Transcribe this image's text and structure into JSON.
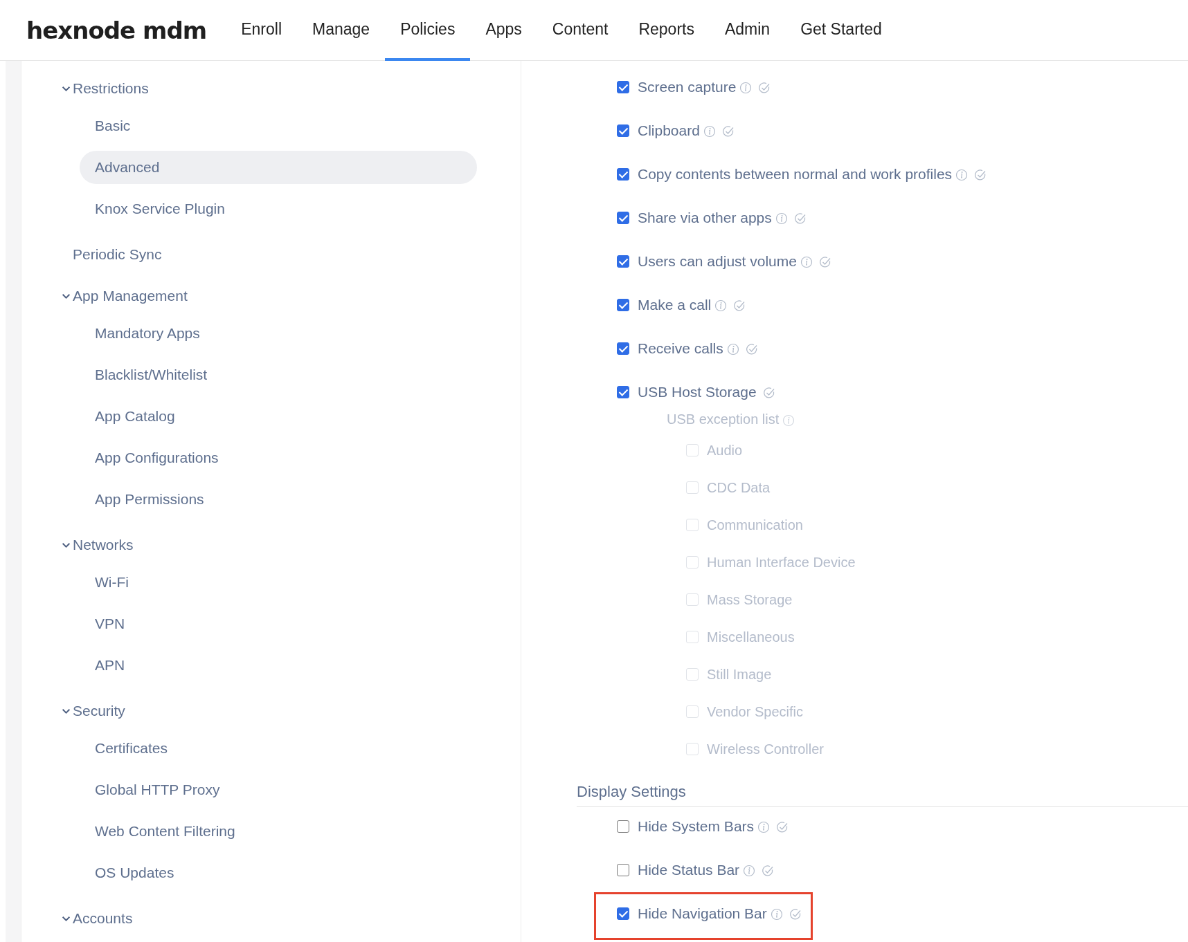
{
  "header": {
    "logo": "hexnode mdm",
    "nav": [
      {
        "label": "Enroll",
        "selected": false
      },
      {
        "label": "Manage",
        "selected": false
      },
      {
        "label": "Policies",
        "selected": true
      },
      {
        "label": "Apps",
        "selected": false
      },
      {
        "label": "Content",
        "selected": false
      },
      {
        "label": "Reports",
        "selected": false
      },
      {
        "label": "Admin",
        "selected": false
      },
      {
        "label": "Get Started",
        "selected": false
      }
    ]
  },
  "sidebar": {
    "items": [
      {
        "label": "Restrictions",
        "expanded": true,
        "children": [
          {
            "label": "Basic",
            "selected": false
          },
          {
            "label": "Advanced",
            "selected": true
          },
          {
            "label": "Knox Service Plugin",
            "selected": false
          }
        ]
      },
      {
        "label": "Periodic Sync"
      },
      {
        "label": "App Management",
        "expanded": true,
        "children": [
          {
            "label": "Mandatory Apps",
            "selected": false
          },
          {
            "label": "Blacklist/Whitelist",
            "selected": false
          },
          {
            "label": "App Catalog",
            "selected": false
          },
          {
            "label": "App Configurations",
            "selected": false
          },
          {
            "label": "App Permissions",
            "selected": false
          }
        ]
      },
      {
        "label": "Networks",
        "expanded": true,
        "children": [
          {
            "label": "Wi-Fi",
            "selected": false
          },
          {
            "label": "VPN",
            "selected": false
          },
          {
            "label": "APN",
            "selected": false
          }
        ]
      },
      {
        "label": "Security",
        "expanded": true,
        "children": [
          {
            "label": "Certificates",
            "selected": false
          },
          {
            "label": "Global HTTP Proxy",
            "selected": false
          },
          {
            "label": "Web Content Filtering",
            "selected": false
          },
          {
            "label": "OS Updates",
            "selected": false
          }
        ]
      },
      {
        "label": "Accounts",
        "expanded": true
      }
    ]
  },
  "options": [
    {
      "label": "Screen capture",
      "checked": true,
      "info": true
    },
    {
      "label": "Clipboard",
      "checked": true,
      "info": true
    },
    {
      "label": "Copy contents between normal and work profiles",
      "checked": true,
      "info": true
    },
    {
      "label": "Share via other apps",
      "checked": true,
      "info": true
    },
    {
      "label": "Users can adjust volume",
      "checked": true,
      "info": true
    },
    {
      "label": "Make a call",
      "checked": true,
      "info": true
    },
    {
      "label": "Receive calls",
      "checked": true,
      "info": true
    },
    {
      "label": "USB Host Storage",
      "checked": true,
      "info": false
    }
  ],
  "usb_exception_list": {
    "label": "USB exception list",
    "disabled": true,
    "items": [
      {
        "label": "Audio",
        "checked": false
      },
      {
        "label": "CDC Data",
        "checked": false
      },
      {
        "label": "Communication",
        "checked": false
      },
      {
        "label": "Human Interface Device",
        "checked": false
      },
      {
        "label": "Mass Storage",
        "checked": false
      },
      {
        "label": "Miscellaneous",
        "checked": false
      },
      {
        "label": "Still Image",
        "checked": false
      },
      {
        "label": "Vendor Specific",
        "checked": false
      },
      {
        "label": "Wireless Controller",
        "checked": false
      }
    ]
  },
  "display_settings": {
    "title": "Display Settings",
    "options": [
      {
        "label": "Hide System Bars",
        "checked": false,
        "info": true,
        "highlighted": false
      },
      {
        "label": "Hide Status Bar",
        "checked": false,
        "info": true,
        "highlighted": false
      },
      {
        "label": "Hide Navigation Bar",
        "checked": true,
        "info": true,
        "highlighted": true
      }
    ]
  }
}
